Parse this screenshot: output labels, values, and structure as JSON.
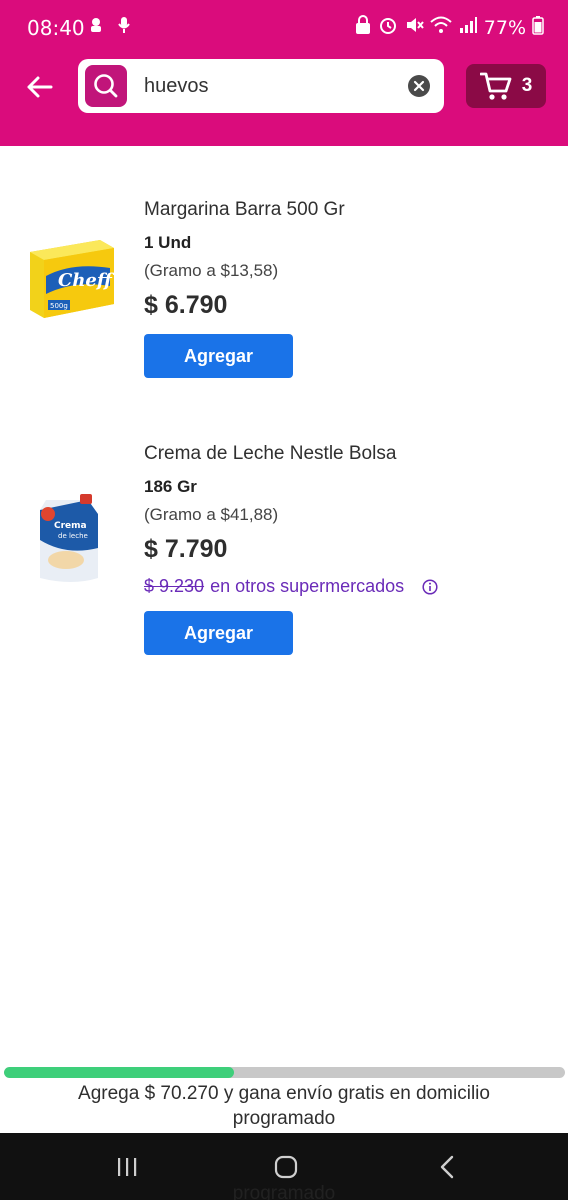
{
  "status_bar": {
    "time": "08:40",
    "battery": "77%"
  },
  "search": {
    "value": "huevos",
    "placeholder": ""
  },
  "cart": {
    "count": "3"
  },
  "products": [
    {
      "name": "Margarina Barra 500 Gr",
      "unit": "1 Und",
      "per_gram": "(Gramo a $13,58)",
      "price": "$ 6.790",
      "add_label": "Agregar",
      "image_icon": "margarine-box-image"
    },
    {
      "name": "Crema de Leche Nestle Bolsa",
      "unit": "186 Gr",
      "per_gram": "(Gramo a $41,88)",
      "price": "$ 7.790",
      "compare_old_price": "$ 9.230",
      "compare_text": "en otros supermercados",
      "add_label": "Agregar",
      "image_icon": "cream-pouch-image"
    }
  ],
  "shipping": {
    "progress_fraction": 0.41,
    "message": "Agrega $ 70.270 y gana envío gratis en domicilio programado",
    "ghost_text": "programado"
  },
  "colors": {
    "brand": "#da0c7c",
    "cart_bg": "#8b0a46",
    "button": "#1a73e8",
    "compare": "#6a2bb8",
    "progress": "#3ecf7a"
  }
}
